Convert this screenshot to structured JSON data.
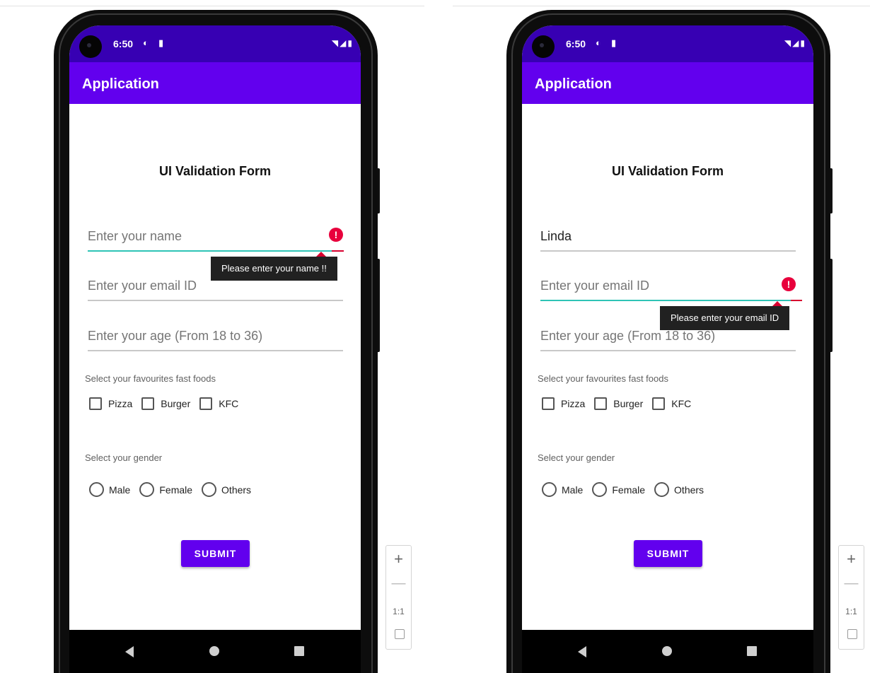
{
  "left": {
    "status_time": "6:50",
    "app_title": "Application",
    "form_title": "UI Validation Form",
    "name_field": {
      "value": "",
      "placeholder": "Enter your name"
    },
    "email_field": {
      "value": "",
      "placeholder": "Enter your email ID"
    },
    "age_field": {
      "value": "",
      "placeholder": "Enter your age (From 18 to 36)"
    },
    "error_tooltip": "Please enter your name !!",
    "food_label": "Select your favourites fast foods",
    "foods": [
      "Pizza",
      "Burger",
      "KFC"
    ],
    "gender_label": "Select your gender",
    "genders": [
      "Male",
      "Female",
      "Others"
    ],
    "submit_label": "SUBMIT"
  },
  "right": {
    "status_time": "6:50",
    "app_title": "Application",
    "form_title": "UI Validation Form",
    "name_field": {
      "value": "Linda",
      "placeholder": "Enter your name"
    },
    "email_field": {
      "value": "",
      "placeholder": "Enter your email ID"
    },
    "age_field": {
      "value": "",
      "placeholder": "Enter your age (From 18 to 36)"
    },
    "error_tooltip": "Please enter your email ID",
    "food_label": "Select your favourites fast foods",
    "foods": [
      "Pizza",
      "Burger",
      "KFC"
    ],
    "gender_label": "Select your gender",
    "genders": [
      "Male",
      "Female",
      "Others"
    ],
    "submit_label": "SUBMIT"
  },
  "zoom_controls": {
    "zoom_in": "+",
    "zoom_out": "—",
    "actual_size": "1:1"
  },
  "colors": {
    "status_bar": "#3700b3",
    "app_bar": "#6200ee",
    "error": "#e8003c",
    "focus_underline": "#2ec4b6"
  },
  "icons": {
    "status": [
      "data-saver-icon",
      "sd-card-icon",
      "wifi-icon",
      "signal-icon",
      "battery-icon"
    ],
    "error": "error-circle-icon"
  }
}
